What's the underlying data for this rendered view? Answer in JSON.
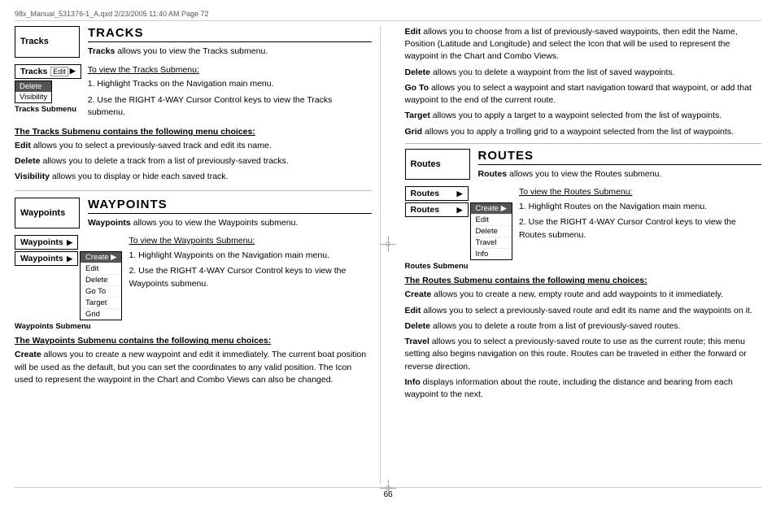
{
  "fileInfo": {
    "left": "98x_Manual_531376-1_A.qxd   2/23/2005   11:40 AM   Page 72"
  },
  "tracks": {
    "sectionLabel": "Tracks",
    "sectionTitle": "TRACKS",
    "sectionDesc": "allows you to view the Tracks submenu.",
    "mainItemLabel": "Tracks",
    "editLabel": "Edit",
    "subItems": [
      "Delete",
      "Visibility"
    ],
    "subLabel": "Tracks Submenu",
    "toViewHeading": "To view the Tracks Submenu:",
    "steps": [
      "1. Highlight Tracks on the Navigation main menu.",
      "2. Use the RIGHT 4-WAY Cursor Control keys to view the Tracks submenu."
    ],
    "submenuHeading": "The Tracks Submenu contains the following menu choices:",
    "editDesc": "allows you to select a previously-saved track and edit its name.",
    "deleteDesc": "allows you to delete a track from a list of previously-saved tracks.",
    "visibilityDesc": "allows you to display or hide each saved track."
  },
  "waypoints": {
    "sectionLabel": "Waypoints",
    "sectionTitle": "WAYPOINTS",
    "sectionDesc": "allows you to view the Waypoints submenu.",
    "mainItemLabel": "Waypoints",
    "subItems": [
      "Create ▶",
      "Edit",
      "Delete",
      "Go To",
      "Target",
      "Grid"
    ],
    "subItemsHighlight": "Create ▶",
    "subLabel": "Waypoints Submenu",
    "toViewHeading": "To view the Waypoints Submenu:",
    "steps": [
      "1. Highlight Waypoints on the Navigation main menu.",
      "2. Use the RIGHT 4-WAY Cursor Control keys to view the Waypoints submenu."
    ],
    "submenuHeading": "The Waypoints Submenu contains the following menu choices:",
    "createDesc": "allows you to create a new waypoint and edit it immediately. The current boat position will be used as the default, but you can set the coordinates to any valid position. The Icon used to represent the waypoint in the Chart and Combo Views can also be changed.",
    "editDesc": "allows you to choose from a list of previously-saved waypoints, then edit the Name, Position (Latitude and Longitude) and select the Icon that will be used to represent the waypoint in the Chart and Combo Views.",
    "deleteDesc": "allows you to delete a waypoint from the list of saved waypoints.",
    "goToDesc": "allows you to select a waypoint and start navigation toward that waypoint, or add that waypoint to the end of the current route.",
    "targetDesc": "allows you to apply a target to a waypoint selected from the list of waypoints.",
    "gridDesc": "allows you to apply a trolling grid to a waypoint selected from the list of waypoints."
  },
  "routes": {
    "sectionLabel": "Routes",
    "sectionTitle": "ROUTES",
    "sectionDesc": "allows you to view the Routes submenu.",
    "mainItemLabel": "Routes",
    "subItems": [
      "Create ▶",
      "Edit",
      "Delete",
      "Travel",
      "Info"
    ],
    "subItemsHighlight": "Create ▶",
    "subLabel": "Routes Submenu",
    "toViewHeading": "To view the Routes Submenu:",
    "steps": [
      "1. Highlight Routes on the Navigation main menu.",
      "2. Use the RIGHT 4-WAY Cursor Control keys to view the Routes submenu."
    ],
    "submenuHeading": "The Routes Submenu contains the following menu choices:",
    "createDesc": "allows you to create a new, empty route and add waypoints to it immediately.",
    "editDesc": "allows you to select a previously-saved route and edit its name and the waypoints on it.",
    "deleteDesc": "allows you to delete a route from a list of previously-saved routes.",
    "travelDesc": "allows you to select a previously-saved route to use as the current route; this menu setting also begins navigation on this route. Routes can be traveled in either the forward or reverse direction.",
    "infoDesc": "displays information about the route, including the distance and bearing from each waypoint to the next."
  },
  "pageNumber": "66"
}
